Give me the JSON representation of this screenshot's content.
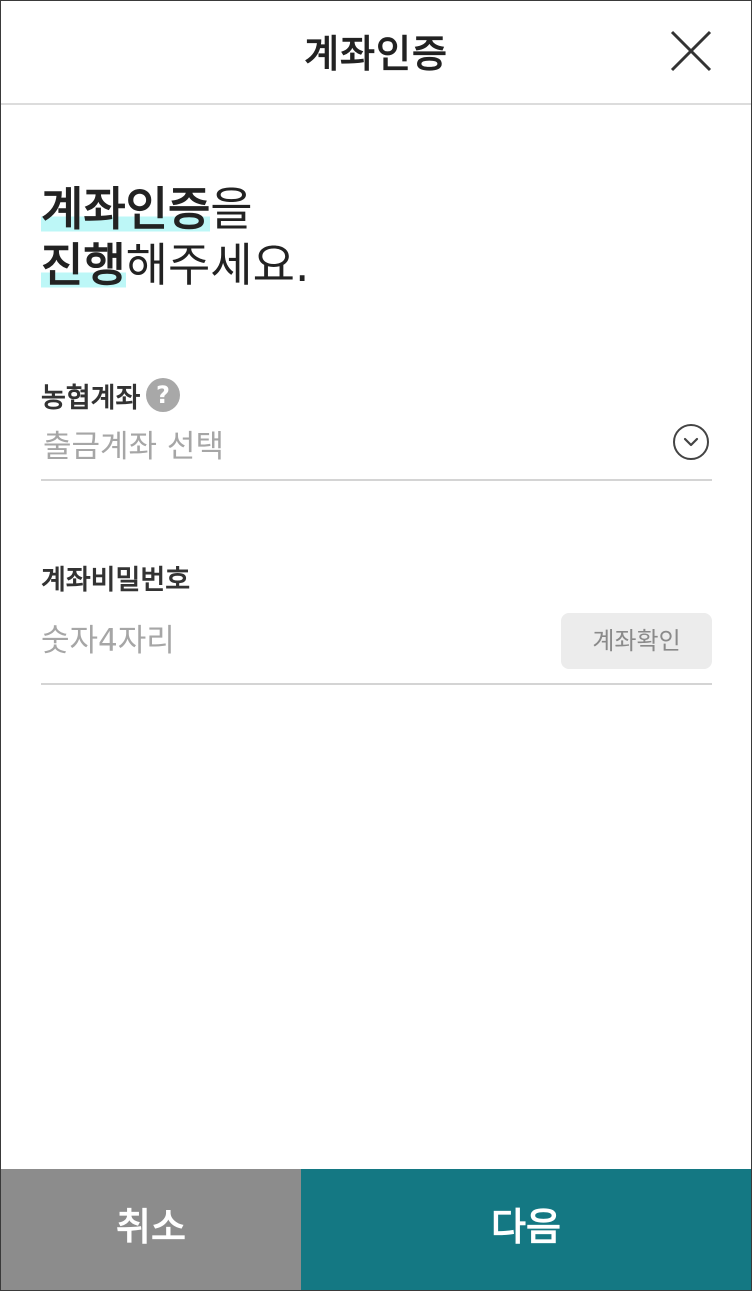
{
  "header": {
    "title": "계좌인증",
    "close_icon": "close-icon"
  },
  "headline": {
    "line1_strong": "계좌인증",
    "line1_rest": "을",
    "line2_strong": "진행",
    "line2_rest": "해주세요."
  },
  "account": {
    "label": "농협계좌",
    "help_icon_text": "?",
    "placeholder": "출금계좌 선택",
    "dropdown_icon": "chevron-down-circle-icon"
  },
  "password": {
    "label": "계좌비밀번호",
    "placeholder": "숫자4자리",
    "value": "",
    "verify_label": "계좌확인"
  },
  "footer": {
    "cancel_label": "취소",
    "next_label": "다음"
  },
  "colors": {
    "accent": "#147883",
    "cancel": "#8c8c8c",
    "highlight": "#bdf7f7"
  }
}
